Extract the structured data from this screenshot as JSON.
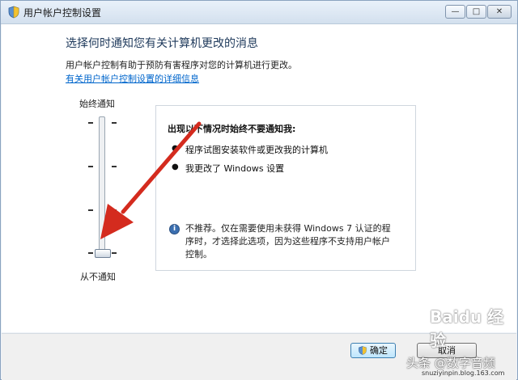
{
  "window": {
    "title": "用户帐户控制设置",
    "controls": {
      "minimize": "—",
      "maximize": "□",
      "close": "✕"
    }
  },
  "main": {
    "heading": "选择何时通知您有关计算机更改的消息",
    "description": "用户帐户控制有助于预防有害程序对您的计算机进行更改。",
    "link": "有关用户帐户控制设置的详细信息"
  },
  "slider": {
    "top_label": "始终通知",
    "bottom_label": "从不通知",
    "levels": 4,
    "selected_level": 1
  },
  "panel": {
    "title": "出现以下情况时始终不要通知我:",
    "bullets": [
      "程序试图安装软件或更改我的计算机",
      "我更改了 Windows 设置"
    ],
    "info_lines": [
      "不推荐。仅在需要使用未获得 Windows 7 认证的程",
      "序时，才选择此选项，因为这些程序不支持用户帐户",
      "控制。"
    ]
  },
  "buttons": {
    "ok": "确定",
    "cancel": "取消"
  },
  "watermarks": {
    "source": "头条 @数字音频",
    "site": "Baidu 经验",
    "url": "snuziyinpin.blog.163.com"
  },
  "colors": {
    "arrow": "#d42b1e",
    "link": "#0066cc",
    "heading": "#1e395b"
  }
}
